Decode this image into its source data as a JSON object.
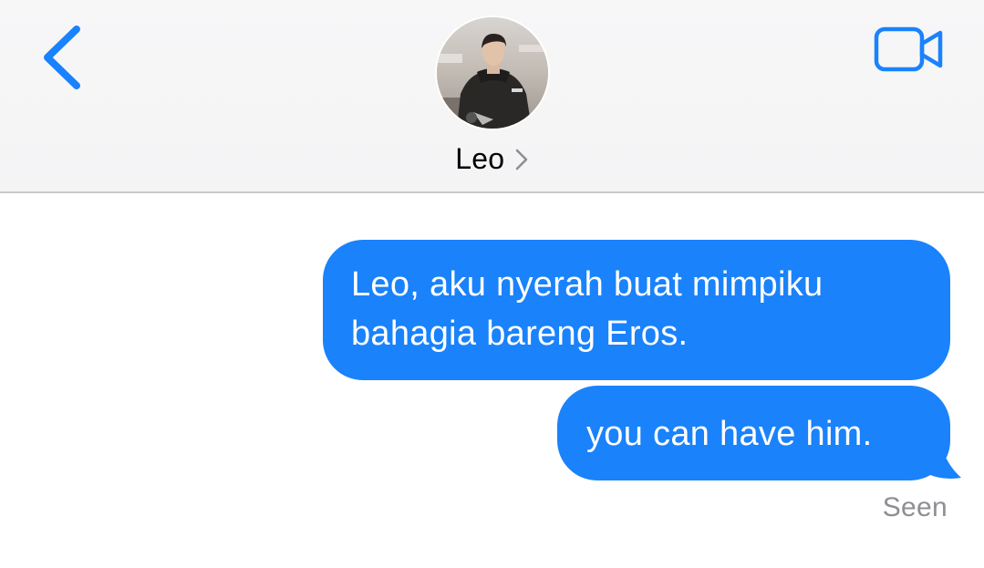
{
  "header": {
    "contact_name": "Leo",
    "back_icon": "chevron-left-icon",
    "video_icon": "video-camera-icon",
    "name_chevron_icon": "chevron-right-icon"
  },
  "messages": [
    {
      "direction": "outgoing",
      "text": "Leo, aku nyerah buat mimpiku\nbahagia bareng Eros."
    },
    {
      "direction": "outgoing",
      "text": "you can have him."
    }
  ],
  "status": {
    "seen_label": "Seen"
  },
  "colors": {
    "accent_blue": "#1a82fb",
    "header_bg": "#f6f6f7",
    "status_gray": "#8e8e93"
  }
}
